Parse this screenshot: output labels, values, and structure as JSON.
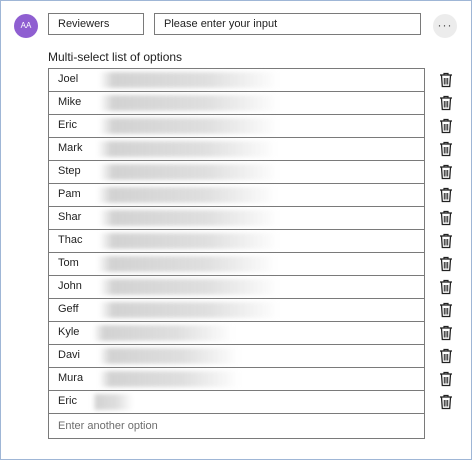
{
  "header": {
    "avatar_initials": "AA",
    "title_value": "Reviewers",
    "prompt_value": "Please enter your input",
    "more_label": "···"
  },
  "list": {
    "label": "Multi-select list of options",
    "options": [
      {
        "name": "Joel"
      },
      {
        "name": "Mike"
      },
      {
        "name": "Eric"
      },
      {
        "name": "Mark"
      },
      {
        "name": "Step"
      },
      {
        "name": "Pam"
      },
      {
        "name": "Shar"
      },
      {
        "name": "Thac"
      },
      {
        "name": "Tom"
      },
      {
        "name": "John"
      },
      {
        "name": "Geff"
      },
      {
        "name": "Kyle"
      },
      {
        "name": "Davi"
      },
      {
        "name": "Mura"
      },
      {
        "name": "Eric"
      }
    ],
    "add_placeholder": "Enter another option"
  },
  "colors": {
    "avatar_bg": "#8f5fd1",
    "border": "#7a7a7a",
    "frame_border": "#9fb6d6"
  },
  "icons": {
    "delete": "trash-icon",
    "more": "more-options-icon"
  }
}
